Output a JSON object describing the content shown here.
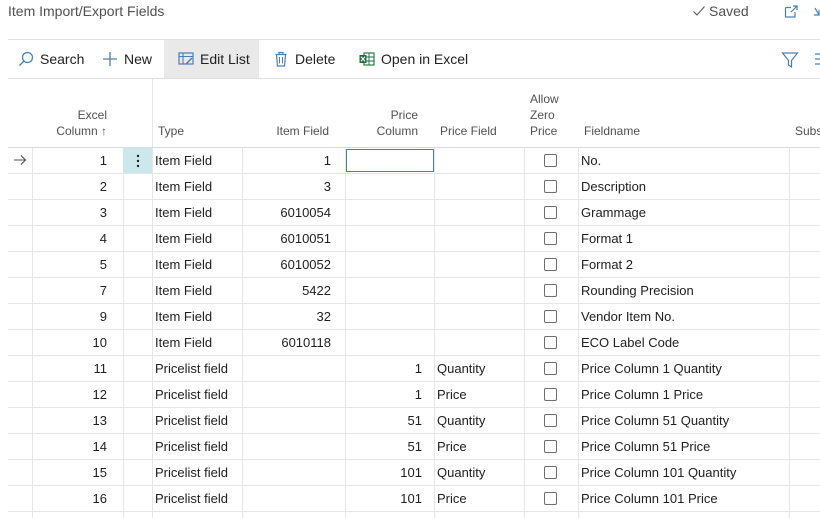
{
  "page": {
    "title": "Item Import/Export Fields",
    "saved_label": "Saved"
  },
  "actions": {
    "search": "Search",
    "new": "New",
    "edit_list": "Edit List",
    "delete": "Delete",
    "open_in_excel": "Open in Excel"
  },
  "columns": {
    "excel_column": "Excel\nColumn ↑",
    "type": "Type",
    "item_field": "Item Field",
    "price_column": "Price\nColumn",
    "price_field": "Price Field",
    "allow_zero_price": "Allow\nZero\nPrice",
    "fieldname": "Fieldname",
    "subs": "Subs"
  },
  "rows": [
    {
      "excel_column": "1",
      "type": "Item Field",
      "item_field": "1",
      "price_column": "",
      "price_field": "",
      "allow_zero_price": false,
      "fieldname": "No."
    },
    {
      "excel_column": "2",
      "type": "Item Field",
      "item_field": "3",
      "price_column": "",
      "price_field": "",
      "allow_zero_price": false,
      "fieldname": "Description"
    },
    {
      "excel_column": "3",
      "type": "Item Field",
      "item_field": "6010054",
      "price_column": "",
      "price_field": "",
      "allow_zero_price": false,
      "fieldname": "Grammage"
    },
    {
      "excel_column": "4",
      "type": "Item Field",
      "item_field": "6010051",
      "price_column": "",
      "price_field": "",
      "allow_zero_price": false,
      "fieldname": "Format 1"
    },
    {
      "excel_column": "5",
      "type": "Item Field",
      "item_field": "6010052",
      "price_column": "",
      "price_field": "",
      "allow_zero_price": false,
      "fieldname": "Format 2"
    },
    {
      "excel_column": "7",
      "type": "Item Field",
      "item_field": "5422",
      "price_column": "",
      "price_field": "",
      "allow_zero_price": false,
      "fieldname": "Rounding Precision"
    },
    {
      "excel_column": "9",
      "type": "Item Field",
      "item_field": "32",
      "price_column": "",
      "price_field": "",
      "allow_zero_price": false,
      "fieldname": "Vendor Item No."
    },
    {
      "excel_column": "10",
      "type": "Item Field",
      "item_field": "6010118",
      "price_column": "",
      "price_field": "",
      "allow_zero_price": false,
      "fieldname": "ECO Label Code"
    },
    {
      "excel_column": "11",
      "type": "Pricelist field",
      "item_field": "",
      "price_column": "1",
      "price_field": "Quantity",
      "allow_zero_price": false,
      "fieldname": "Price Column 1 Quantity"
    },
    {
      "excel_column": "12",
      "type": "Pricelist field",
      "item_field": "",
      "price_column": "1",
      "price_field": "Price",
      "allow_zero_price": false,
      "fieldname": "Price Column 1 Price"
    },
    {
      "excel_column": "13",
      "type": "Pricelist field",
      "item_field": "",
      "price_column": "51",
      "price_field": "Quantity",
      "allow_zero_price": false,
      "fieldname": "Price Column 51 Quantity"
    },
    {
      "excel_column": "14",
      "type": "Pricelist field",
      "item_field": "",
      "price_column": "51",
      "price_field": "Price",
      "allow_zero_price": false,
      "fieldname": "Price Column 51 Price"
    },
    {
      "excel_column": "15",
      "type": "Pricelist field",
      "item_field": "",
      "price_column": "101",
      "price_field": "Quantity",
      "allow_zero_price": false,
      "fieldname": "Price Column 101 Quantity"
    },
    {
      "excel_column": "16",
      "type": "Pricelist field",
      "item_field": "",
      "price_column": "101",
      "price_field": "Price",
      "allow_zero_price": false,
      "fieldname": "Price Column 101 Price"
    }
  ],
  "current_row_index": 0,
  "icons": {
    "saved": "checkmark-icon",
    "popout": "open-in-new-window-icon",
    "collapse": "collapse-icon",
    "search": "search-icon",
    "new": "plus-icon",
    "edit_list": "edit-list-icon",
    "delete": "trash-icon",
    "open_in_excel": "excel-icon",
    "filter": "filter-icon",
    "more": "more-options-icon",
    "current_row": "right-arrow-icon",
    "row_actions": "vertical-ellipsis-icon"
  },
  "colors": {
    "accent": "#4a7fb5",
    "active_cell": "#cde8ec",
    "excel_green": "#1d6f42"
  }
}
